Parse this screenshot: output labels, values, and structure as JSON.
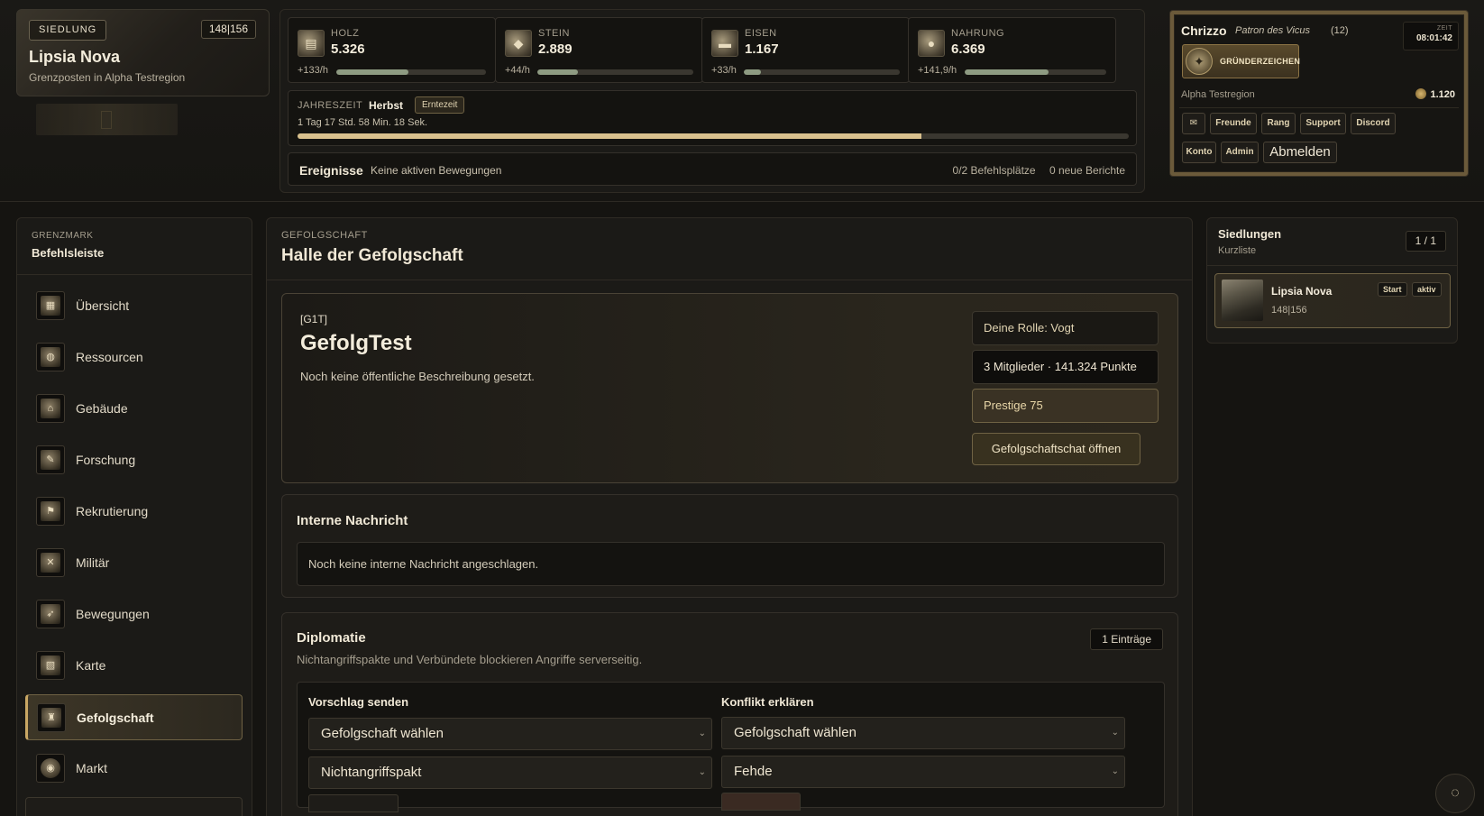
{
  "settlement": {
    "tag": "SIEDLUNG",
    "coords": "148|156",
    "name": "Lipsia Nova",
    "subtitle": "Grenzposten in Alpha Testregion"
  },
  "resources": [
    {
      "label": "HOLZ",
      "value": "5.326",
      "rate": "+133/h",
      "fill": 0.48,
      "icon": "wood-icon"
    },
    {
      "label": "STEIN",
      "value": "2.889",
      "rate": "+44/h",
      "fill": 0.26,
      "icon": "stone-icon"
    },
    {
      "label": "EISEN",
      "value": "1.167",
      "rate": "+33/h",
      "fill": 0.11,
      "icon": "iron-icon"
    },
    {
      "label": "NAHRUNG",
      "value": "6.369",
      "rate": "+141,9/h",
      "fill": 0.59,
      "icon": "food-icon"
    }
  ],
  "season": {
    "label": "JAHRESZEIT",
    "value": "Herbst",
    "badge": "Erntezeit",
    "timer": "1 Tag 17 Std. 58 Min. 18 Sek.",
    "progress": 0.75
  },
  "events": {
    "title": "Ereignisse",
    "status": "Keine aktiven Bewegungen",
    "slots": "0/2 Befehlsplätze",
    "reports": "0 neue Berichte"
  },
  "user": {
    "name": "Chrizzo",
    "title": "Patron des Vicus",
    "level": "(12)",
    "clock_label": "ZEIT",
    "clock_value": "08:01:42",
    "founder": "GRÜNDERZEICHEN",
    "region": "Alpha Testregion",
    "gold": "1.120",
    "buttons": {
      "mail": "✉",
      "friends": "Freunde",
      "rank": "Rang",
      "support": "Support",
      "discord": "Discord",
      "account": "Konto",
      "admin": "Admin",
      "logout": "Abmelden"
    }
  },
  "sidebar": {
    "kicker": "GRENZMARK",
    "title": "Befehlsleiste",
    "items": [
      {
        "label": "Übersicht",
        "icon": "overview-icon"
      },
      {
        "label": "Ressourcen",
        "icon": "resources-icon"
      },
      {
        "label": "Gebäude",
        "icon": "buildings-icon"
      },
      {
        "label": "Forschung",
        "icon": "research-icon"
      },
      {
        "label": "Rekrutierung",
        "icon": "recruit-icon"
      },
      {
        "label": "Militär",
        "icon": "swords-icon"
      },
      {
        "label": "Bewegungen",
        "icon": "movement-icon"
      },
      {
        "label": "Karte",
        "icon": "map-icon"
      },
      {
        "label": "Gefolgschaft",
        "icon": "guild-icon",
        "active": true
      },
      {
        "label": "Markt",
        "icon": "market-icon"
      }
    ]
  },
  "main": {
    "kicker": "GEFOLGSCHAFT",
    "title": "Halle der Gefolgschaft",
    "guild": {
      "tag": "[G1T]",
      "name": "GefolgTest",
      "description": "Noch keine öffentliche Beschreibung gesetzt.",
      "role": "Deine Rolle: Vogt",
      "members": "3 Mitglieder · 141.324 Punkte",
      "prestige": "Prestige 75",
      "chat_button": "Gefolgschaftschat öffnen"
    },
    "internal": {
      "title": "Interne Nachricht",
      "text": "Noch keine interne Nachricht angeschlagen."
    },
    "diplomacy": {
      "title": "Diplomatie",
      "subtitle": "Nichtangriffspakte und Verbündete blockieren Angriffe serverseitig.",
      "count": "1 Einträge",
      "propose_title": "Vorschlag senden",
      "propose_guild": "Gefolgschaft wählen",
      "propose_type": "Nichtangriffspakt",
      "conflict_title": "Konflikt erklären",
      "conflict_guild": "Gefolgschaft wählen",
      "conflict_type": "Fehde"
    }
  },
  "settlements_panel": {
    "title": "Siedlungen",
    "subtitle": "Kurzliste",
    "count": "1 / 1",
    "item": {
      "name": "Lipsia Nova",
      "coords": "148|156",
      "start": "Start",
      "active": "aktiv"
    }
  },
  "colors": {
    "accent": "#c9a764",
    "background": "#151411",
    "panel": "#1b1a17"
  }
}
